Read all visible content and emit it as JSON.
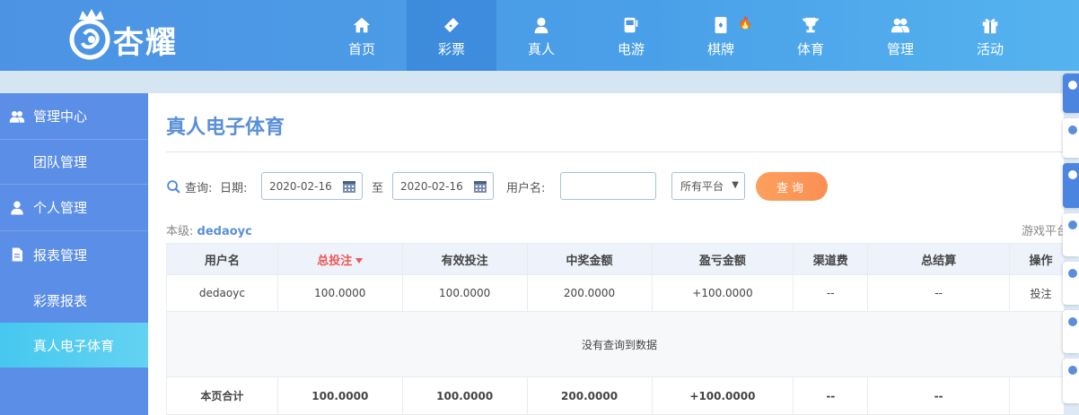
{
  "header": {
    "logo_text": "杏耀",
    "nav": [
      {
        "label": "首页",
        "icon": "home-icon",
        "active": false
      },
      {
        "label": "彩票",
        "icon": "ticket-icon",
        "active": true
      },
      {
        "label": "真人",
        "icon": "live-dealer-icon",
        "active": false
      },
      {
        "label": "电游",
        "icon": "slot-machine-icon",
        "active": false
      },
      {
        "label": "棋牌",
        "icon": "card-icon",
        "active": false
      },
      {
        "label": "体育",
        "icon": "trophy-icon",
        "active": false
      },
      {
        "label": "管理",
        "icon": "users-icon",
        "active": false
      },
      {
        "label": "活动",
        "icon": "gift-icon",
        "active": false
      }
    ]
  },
  "sidebar": {
    "items": [
      {
        "label": "管理中心",
        "type": "group",
        "icon": "users-icon"
      },
      {
        "label": "团队管理",
        "type": "sub"
      },
      {
        "label": "个人管理",
        "type": "group",
        "icon": "user-icon"
      },
      {
        "label": "报表管理",
        "type": "group",
        "icon": "report-icon"
      },
      {
        "label": "彩票报表",
        "type": "sub"
      },
      {
        "label": "真人电子体育",
        "type": "sub",
        "active": true
      }
    ]
  },
  "main": {
    "title": "真人电子体育",
    "filter": {
      "query_label": "查询:",
      "date_label": "日期:",
      "date_from": "2020-02-16",
      "to_label": "至",
      "date_to": "2020-02-16",
      "username_label": "用户名:",
      "username_value": "",
      "platform_selected": "所有平台",
      "query_button": "查询"
    },
    "level_label": "本级:",
    "level_user": "dedaoyc",
    "platform_label": "游戏平台",
    "table": {
      "headers": [
        "用户名",
        "总投注",
        "有效投注",
        "中奖金额",
        "盈亏金额",
        "渠道费",
        "总结算",
        "操作"
      ],
      "sorted_column": "总投注",
      "row": [
        "dedaoyc",
        "100.0000",
        "100.0000",
        "200.0000",
        "+100.0000",
        "--",
        "--",
        "投注"
      ],
      "empty_text": "没有查询到数据",
      "total": [
        "本页合计",
        "100.0000",
        "100.0000",
        "200.0000",
        "+100.0000",
        "--",
        "--",
        ""
      ]
    }
  },
  "colors": {
    "header": "#4d93e4",
    "sidebar": "#5b8ee6",
    "sidebar_active": "#46c8f0",
    "accent": "#5a8fd8",
    "query_button": "#fb8f55",
    "profit": "#44a324",
    "sort": "#ef5656"
  }
}
